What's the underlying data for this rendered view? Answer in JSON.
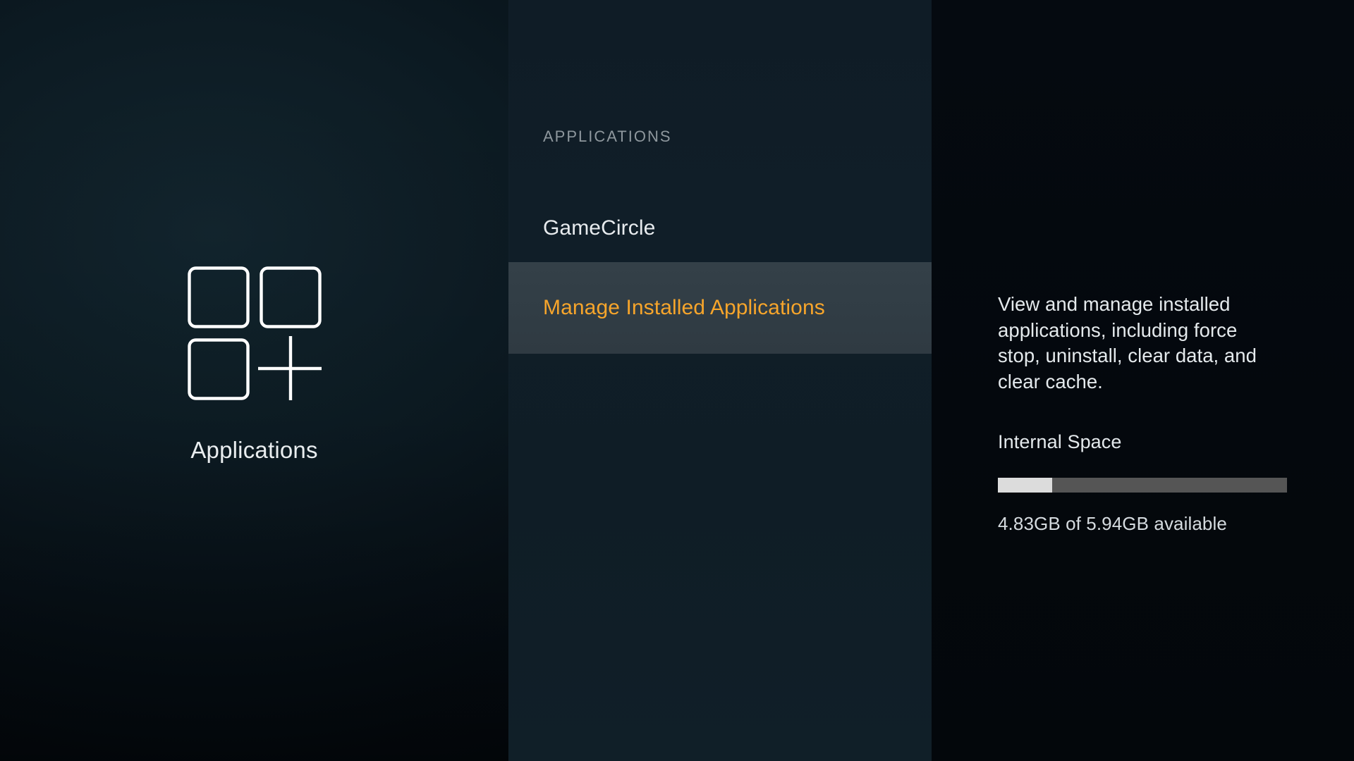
{
  "hero": {
    "icon": "applications-grid-plus-icon",
    "label": "Applications"
  },
  "menu": {
    "header": "APPLICATIONS",
    "items": [
      {
        "label": "GameCircle",
        "selected": false
      },
      {
        "label": "Manage Installed Applications",
        "selected": true
      }
    ]
  },
  "detail": {
    "description": "View and manage installed applications, including force stop, uninstall, clear data, and clear cache.",
    "storage_title": "Internal Space",
    "storage_summary": "4.83GB of 5.94GB available",
    "storage_percent_used": 18.7
  },
  "colors": {
    "accent_orange": "#f7a52b",
    "selected_row_bg": "#333f48",
    "menu_column_bg": "#101e28",
    "detail_column_bg": "#04080d",
    "hero_bg": "#0c1a22",
    "primary_text": "#e7ebee",
    "muted_text": "#8e979d",
    "storage_track": "#555555",
    "storage_fill": "#dcdcdc"
  }
}
